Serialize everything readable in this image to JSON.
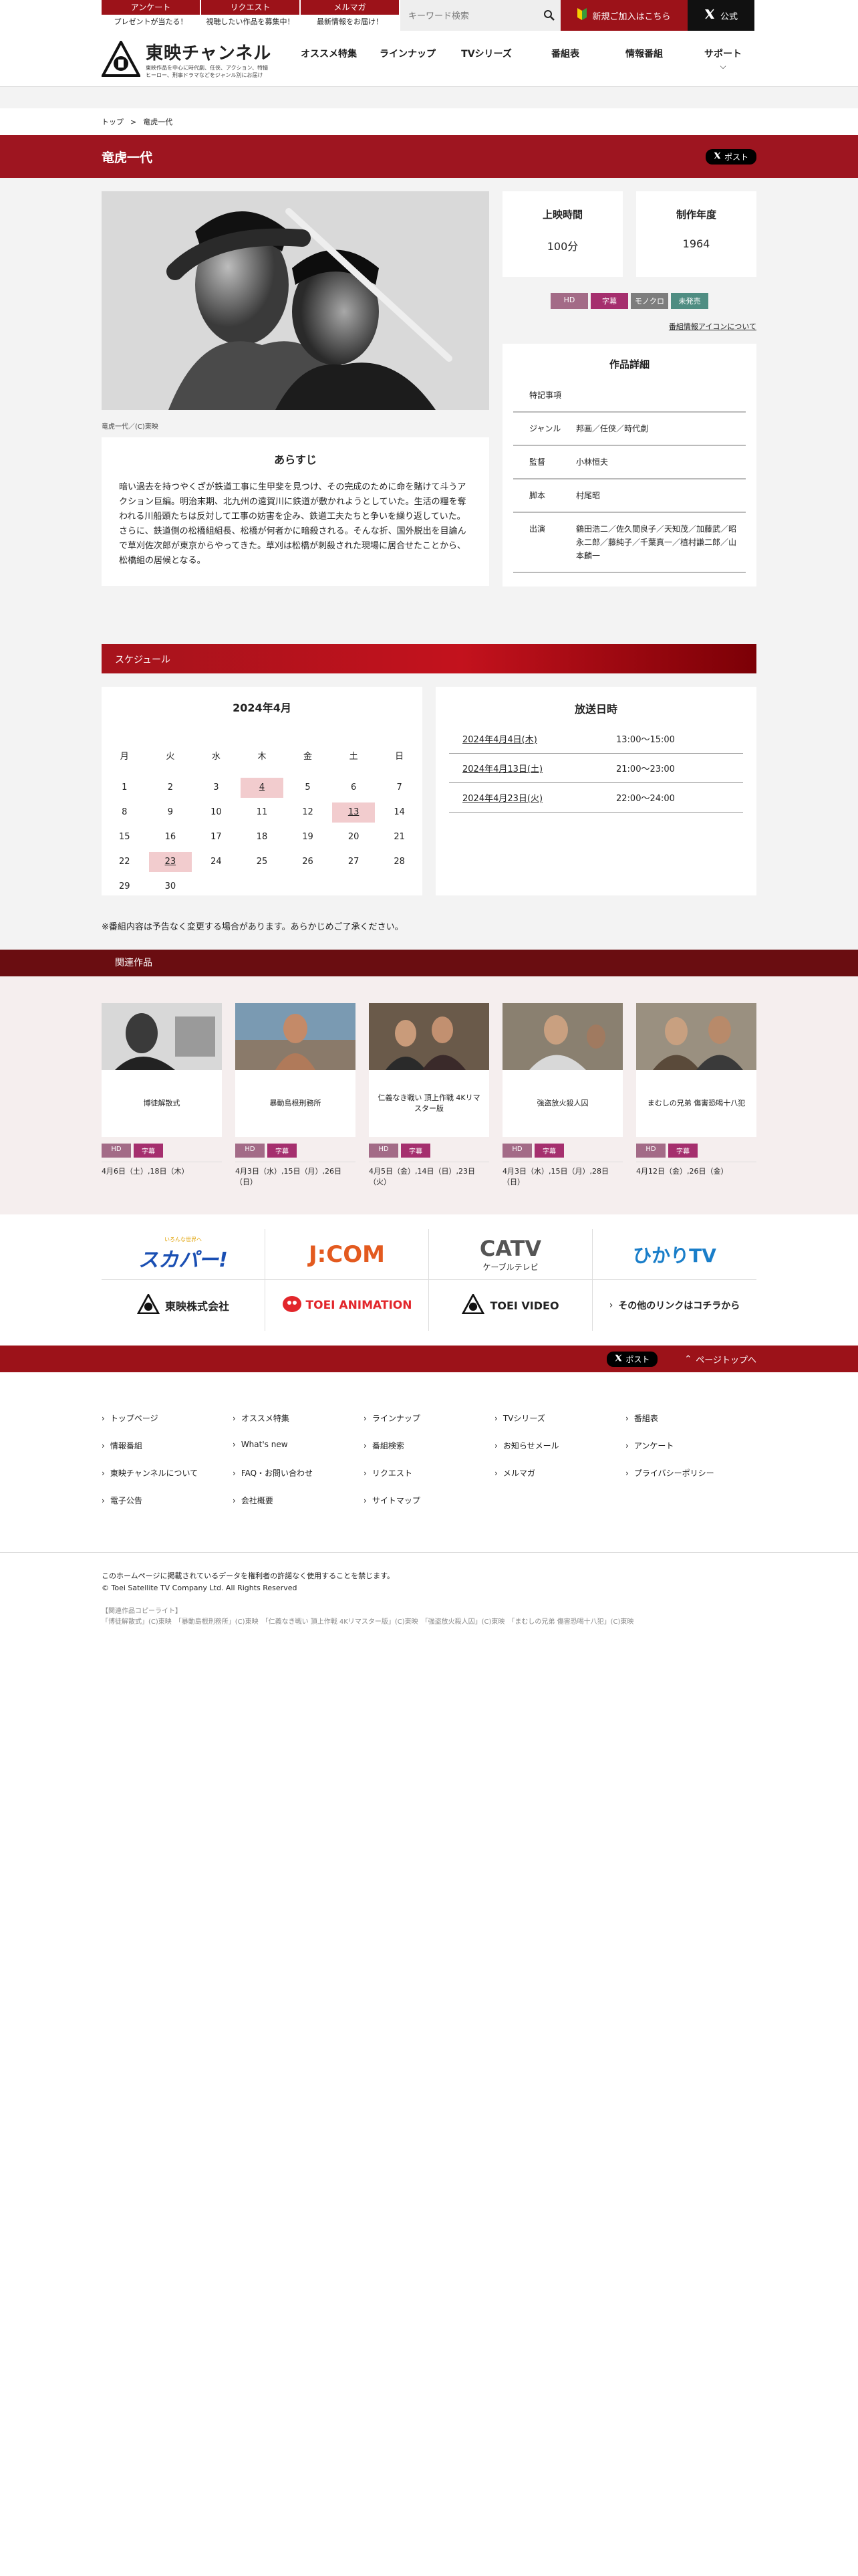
{
  "topbar": {
    "cells": [
      {
        "label": "アンケート",
        "sub": "プレゼントが当たる！"
      },
      {
        "label": "リクエスト",
        "sub": "視聴したい作品を募集中！"
      },
      {
        "label": "メルマガ",
        "sub": "最新情報をお届け！"
      }
    ],
    "search_placeholder": "キーワード検索",
    "join_label": "新規ご加入はこちら",
    "x_label": "公式"
  },
  "header": {
    "logo_name": "東映チャンネル",
    "logo_tag": "東映作品を中心に時代劇、任侠、アクション、特撮ヒーロー、刑事ドラマなどをジャンル別にお届け",
    "nav": [
      {
        "label": "オススメ特集"
      },
      {
        "label": "ラインナップ"
      },
      {
        "label": "TVシリーズ"
      },
      {
        "label": "番組表"
      },
      {
        "label": "情報番組"
      },
      {
        "label": "サポート"
      }
    ]
  },
  "breadcrumb": {
    "home": "トップ",
    "sep": ">",
    "current": "竜虎一代"
  },
  "title": "竜虎一代",
  "xpost_label": "ポスト",
  "still": {
    "caption": "竜虎一代／(C)東映"
  },
  "synopsis": {
    "heading": "あらすじ",
    "text": "暗い過去を持つやくざが鉄道工事に生甲斐を見つけ、その完成のために命を賭けて斗うアクション巨編。明治末期、北九州の遠賀川に鉄道が敷かれようとしていた。生活の糧を奪われる川船頭たちは反対して工事の妨害を企み、鉄道工夫たちと争いを繰り返していた。さらに、鉄道側の松橋組組長、松橋が何者かに暗殺される。そんな折、国外脱出を目論んで草刈佐次郎が東京からやってきた。草刈は松橋が刺殺された現場に居合せたことから、松橋組の居候となる。"
  },
  "info": {
    "runtime_label": "上映時間",
    "runtime": "100分",
    "year_label": "制作年度",
    "year": "1964",
    "badges": [
      "HD",
      "字幕",
      "モノクロ",
      "未発売"
    ],
    "icon_link": "番組情報アイコンについて"
  },
  "details": {
    "heading": "作品詳細",
    "rows": [
      {
        "k": "特記事項",
        "v": ""
      },
      {
        "k": "ジャンル",
        "v": "邦画／任侠／時代劇"
      },
      {
        "k": "監督",
        "v": "小林恒夫"
      },
      {
        "k": "脚本",
        "v": "村尾昭"
      },
      {
        "k": "出演",
        "v": "鶴田浩二／佐久間良子／天知茂／加藤武／昭永二郎／藤純子／千葉真一／植村謙二郎／山本麟一"
      }
    ]
  },
  "schedule": {
    "heading": "スケジュール",
    "month": "2024年4月",
    "weekdays": [
      "月",
      "火",
      "水",
      "木",
      "金",
      "土",
      "日"
    ],
    "weeks": [
      [
        "1",
        "2",
        "3",
        "4",
        "5",
        "6",
        "7"
      ],
      [
        "8",
        "9",
        "10",
        "11",
        "12",
        "13",
        "14"
      ],
      [
        "15",
        "16",
        "17",
        "18",
        "19",
        "20",
        "21"
      ],
      [
        "22",
        "23",
        "24",
        "25",
        "26",
        "27",
        "28"
      ],
      [
        "29",
        "30",
        "",
        "",
        "",
        "",
        ""
      ]
    ],
    "broadcast_heading": "放送日時",
    "broadcasts": [
      {
        "date": "2024年4月4日(木)",
        "time": "13:00〜15:00"
      },
      {
        "date": "2024年4月13日(土)",
        "time": "21:00〜23:00"
      },
      {
        "date": "2024年4月23日(火)",
        "time": "22:00〜24:00"
      }
    ],
    "note": "※番組内容は予告なく変更する場合があります。あらかじめご了承ください。"
  },
  "related": {
    "heading": "関連作品",
    "items": [
      {
        "title": "博徒解散式",
        "dates": "4月6日（土）,18日（木）"
      },
      {
        "title": "暴動島根刑務所",
        "dates": "4月3日（水）,15日（月）,26日（日）"
      },
      {
        "title": "仁義なき戦い 頂上作戦 4Kリマスター版",
        "dates": "4月5日（金）,14日（日）,23日（火）"
      },
      {
        "title": "強盗放火殺人囚",
        "dates": "4月3日（水）,15日（月）,28日（日）"
      },
      {
        "title": "まむしの兄弟 傷害恐喝十八犯",
        "dates": "4月12日（金）,26日（金）"
      }
    ],
    "badge_hd": "HD",
    "badge_sub": "字幕"
  },
  "partners": {
    "skyperfect": "スカパー!",
    "skyperfect_sub": "いろんな世界へ",
    "jcom": "J:COM",
    "catv": "CATV",
    "catv_sub": "ケーブルテレビ",
    "hikari": "ひかりTV",
    "toei": "東映株式会社",
    "toei_anim": "TOEI ANIMATION",
    "toei_video": "TOEI VIDEO",
    "other": "その他のリンクはコチラから"
  },
  "footer": {
    "pagetop": "ページトップへ",
    "links": [
      "トップページ",
      "オススメ特集",
      "ラインナップ",
      "TVシリーズ",
      "番組表",
      "情報番組",
      "What's new",
      "番組検索",
      "お知らせメール",
      "アンケート",
      "東映チャンネルについて",
      "FAQ・お問い合わせ",
      "リクエスト",
      "メルマガ",
      "プライバシーポリシー",
      "電子公告",
      "会社概要",
      "サイトマップ"
    ],
    "notice": "このホームページに掲載されているデータを権利者の許諾なく使用することを禁じます。",
    "copyright": "© Toei Satellite TV Company Ltd. All Rights Reserved",
    "related_credit": "【関連作品コピーライト】",
    "credits": "「博徒解散式」(C)東映　「暴動島根刑務所」(C)東映　「仁義なき戦い 頂上作戦 4Kリマスター版」(C)東映　「強盗放火殺人囚」(C)東映　「まむしの兄弟 傷害恐喝十八犯」(C)東映"
  }
}
